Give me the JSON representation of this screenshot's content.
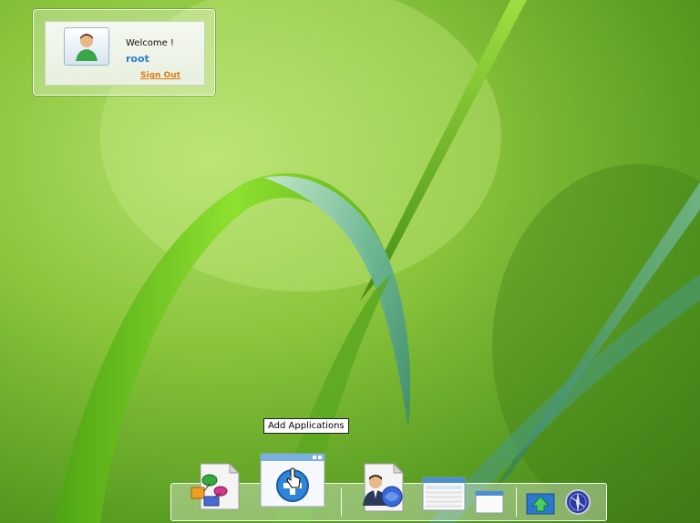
{
  "welcome": {
    "greeting": "Welcome !",
    "username": "root",
    "sign_out": "Sign Out"
  },
  "tooltip": {
    "text": "Add Applications"
  },
  "dock": {
    "items": [
      {
        "name": "network-shapes-icon"
      },
      {
        "name": "add-applications-icon"
      },
      {
        "name": "user-profile-icon"
      },
      {
        "name": "list-window-icon"
      },
      {
        "name": "blank-window-icon"
      },
      {
        "name": "up-arrow-icon"
      },
      {
        "name": "globe-icon"
      }
    ]
  },
  "colors": {
    "username": "#2d7bd0",
    "sign_out": "#e07a10"
  }
}
